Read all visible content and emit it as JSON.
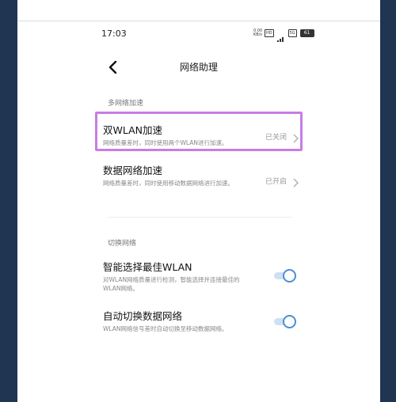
{
  "status_bar": {
    "time": "17:03",
    "net_speed": "0.00 KB/s",
    "hd_label": "HD",
    "signal_label": "5G",
    "battery": "61"
  },
  "header": {
    "title": "网络助理"
  },
  "sections": {
    "multi_network": {
      "header": "多网络加速",
      "dual_wlan": {
        "title": "双WLAN加速",
        "desc": "网络质量差时，同时使用两个WLAN进行加速。",
        "status": "已关闭"
      },
      "mobile_data": {
        "title": "数据网络加速",
        "desc": "网络质量差时，同时使用移动数据网络进行加速。",
        "status": "已开启"
      }
    },
    "switch_network": {
      "header": "切换网络",
      "best_wlan": {
        "title": "智能选择最佳WLAN",
        "desc": "对WLAN网络质量进行检测，智能选择并连接最佳的WLAN网络。",
        "enabled": true
      },
      "auto_switch": {
        "title": "自动切换数据网络",
        "desc": "WLAN网络信号差时自动切换至移动数据网络。",
        "enabled": true
      }
    }
  },
  "colors": {
    "highlight": "#c77de6",
    "toggle_accent": "#4a8fd8",
    "frame": "#1f3552"
  }
}
